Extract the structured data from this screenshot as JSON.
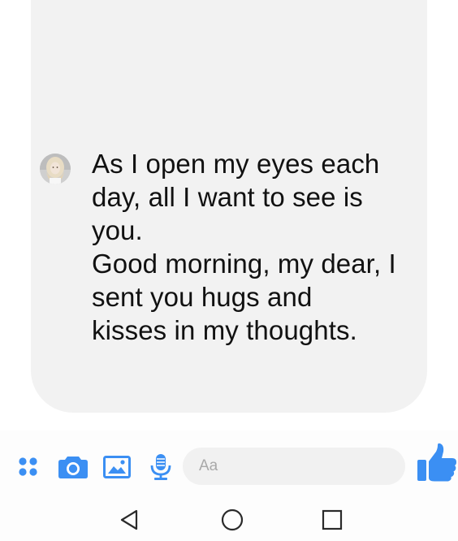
{
  "conversation": {
    "message": {
      "sender_avatar": "contact-avatar",
      "text": "As I open my eyes each\nday, all I want to see is\nyou.\nGood morning, my dear, I\nsent you hugs and\nkisses in my thoughts."
    }
  },
  "composer": {
    "input_placeholder": "Aa",
    "icons": {
      "more": "four-dots-icon",
      "camera": "camera-icon",
      "gallery": "image-icon",
      "voice": "microphone-icon",
      "send_like": "thumbs-up-icon"
    }
  },
  "navigation": {
    "back": "back-triangle-icon",
    "home": "home-circle-icon",
    "recents": "recents-square-icon"
  },
  "colors": {
    "accent": "#3b8ff3",
    "bubble": "#f2f2f2",
    "text": "#111111",
    "nav": "#2a2a2a"
  }
}
